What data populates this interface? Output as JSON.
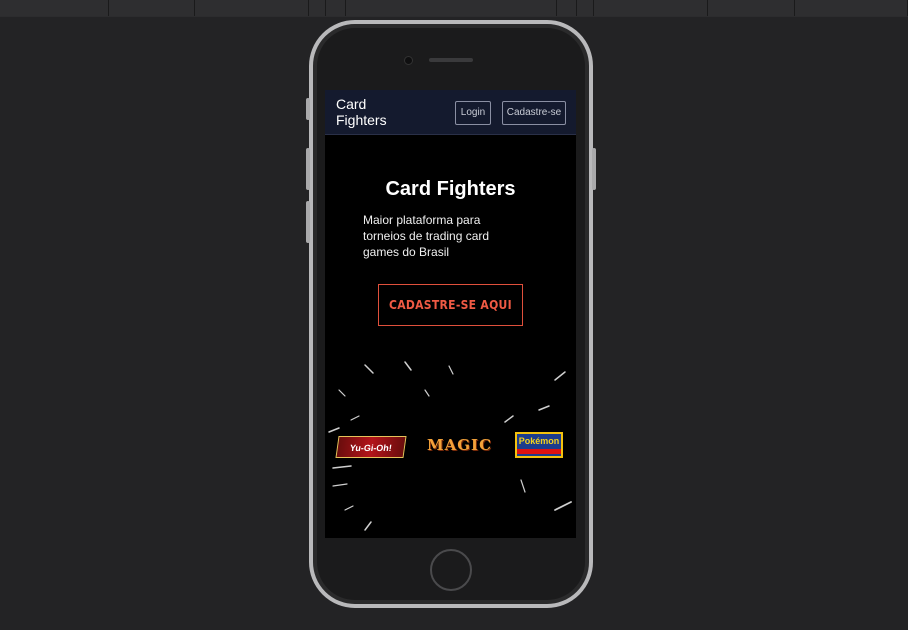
{
  "navbar": {
    "brand": "Card Fighters",
    "login_label": "Login",
    "signup_label": "Cadastre-se"
  },
  "hero": {
    "title": "Card Fighters",
    "subtitle": "Maior plataforma para torneios de trading card games do Brasil",
    "cta_label": "CADASTRE-SE AQUI"
  },
  "logos": {
    "yugioh": "Yu-Gi-Oh!",
    "magic": "MAGIC",
    "pokemon": "Pokémon"
  },
  "colors": {
    "background": "#232325",
    "navbar": "#141a2e",
    "accent": "#f05a44"
  }
}
